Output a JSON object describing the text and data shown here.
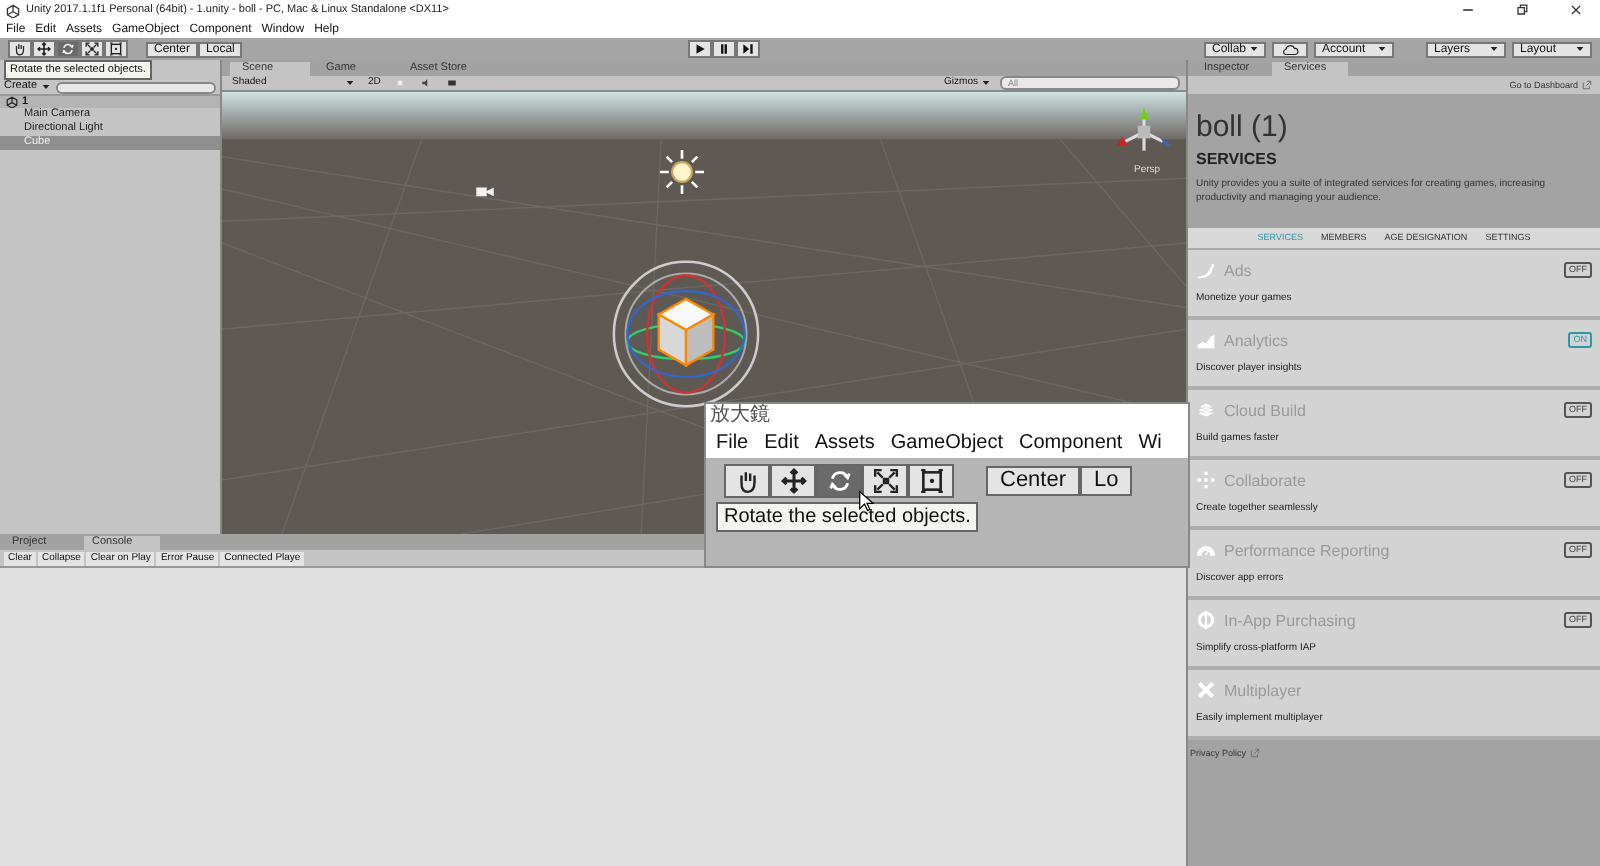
{
  "window": {
    "title": "Unity 2017.1.1f1 Personal (64bit) - 1.unity - boll - PC, Mac & Linux Standalone <DX11>"
  },
  "menu": [
    "File",
    "Edit",
    "Assets",
    "GameObject",
    "Component",
    "Window",
    "Help"
  ],
  "toolbar": {
    "tools": [
      {
        "kind": "hand",
        "selected": false
      },
      {
        "kind": "move",
        "selected": false
      },
      {
        "kind": "rotate",
        "selected": true
      },
      {
        "kind": "scale",
        "selected": false
      },
      {
        "kind": "rect",
        "selected": false
      }
    ],
    "pivot": [
      "Center",
      "Local"
    ],
    "collab": "Collab",
    "account": "Account",
    "layers": "Layers",
    "layout": "Layout"
  },
  "hierarchy": {
    "tooltip": "Rotate the selected objects.",
    "create": "Create",
    "scene": "1",
    "items": [
      {
        "label": "Main Camera",
        "selected": false
      },
      {
        "label": "Directional Light",
        "selected": false
      },
      {
        "label": "Cube",
        "selected": true
      }
    ]
  },
  "scene": {
    "tabs": [
      {
        "label": "Scene",
        "selected": true
      },
      {
        "label": "Game",
        "selected": false
      },
      {
        "label": "Asset Store",
        "selected": false
      }
    ],
    "shading": "Shaded",
    "mode_2d": "2D",
    "gizmos": "Gizmos",
    "search": "All",
    "persp": "Persp"
  },
  "magnifier": {
    "title": "放大鏡",
    "menu": [
      "File",
      "Edit",
      "Assets",
      "GameObject",
      "Component",
      "Wi"
    ],
    "tools": [
      {
        "kind": "hand",
        "selected": false
      },
      {
        "kind": "move",
        "selected": false
      },
      {
        "kind": "rotate",
        "selected": true
      },
      {
        "kind": "scale",
        "selected": false
      },
      {
        "kind": "rect",
        "selected": false
      }
    ],
    "pivot": [
      "Center",
      "Lo"
    ],
    "tooltip": "Rotate the selected objects."
  },
  "inspector": {
    "tabs": [
      {
        "label": "Inspector",
        "selected": false
      },
      {
        "label": "Services",
        "selected": true
      }
    ],
    "dashboard": "Go to Dashboard",
    "project": "boll (1)",
    "heading": "SERVICES",
    "description": "Unity provides you a suite of integrated services for creating games, increasing productivity and managing your audience.",
    "nav": [
      {
        "label": "SERVICES",
        "selected": true
      },
      {
        "label": "MEMBERS",
        "selected": false
      },
      {
        "label": "AGE DESIGNATION",
        "selected": false
      },
      {
        "label": "SETTINGS",
        "selected": false
      }
    ],
    "services": [
      {
        "kind": "ads",
        "name": "Ads",
        "description": "Monetize your games",
        "toggle": {
          "label": "OFF",
          "on": false
        }
      },
      {
        "kind": "analytics",
        "name": "Analytics",
        "description": "Discover player insights",
        "toggle": {
          "label": "ON",
          "on": true
        }
      },
      {
        "kind": "cloud",
        "name": "Cloud Build",
        "description": "Build games faster",
        "toggle": {
          "label": "OFF",
          "on": false
        }
      },
      {
        "kind": "collab",
        "name": "Collaborate",
        "description": "Create together seamlessly",
        "toggle": {
          "label": "OFF",
          "on": false
        }
      },
      {
        "kind": "performance",
        "name": "Performance Reporting",
        "description": "Discover app errors",
        "toggle": {
          "label": "OFF",
          "on": false
        }
      },
      {
        "kind": "iap",
        "name": "In-App Purchasing",
        "description": "Simplify cross-platform IAP",
        "toggle": {
          "label": "OFF",
          "on": false
        }
      },
      {
        "kind": "multiplayer",
        "name": "Multiplayer",
        "description": "Easily implement multiplayer"
      }
    ],
    "privacy": "Privacy Policy"
  },
  "console": {
    "tabs": [
      {
        "label": "Project",
        "selected": false
      },
      {
        "label": "Console",
        "selected": true
      }
    ],
    "buttons": [
      "Clear",
      "Collapse",
      "Clear on Play",
      "Error Pause",
      "Connected Playe"
    ]
  }
}
